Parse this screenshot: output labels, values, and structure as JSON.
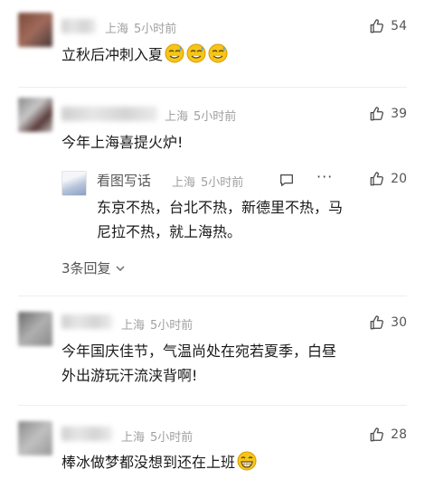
{
  "comments": [
    {
      "location": "上海",
      "time": "5小时前",
      "likes": "54",
      "text": "立秋后冲刺入夏"
    },
    {
      "location": "上海",
      "time": "5小时前",
      "likes": "39",
      "text": "今年上海喜提火炉!",
      "reply": {
        "name": "看图写话",
        "location": "上海",
        "time": "5小时前",
        "likes": "20",
        "text_line1": "东京不热，台北不热，新德里不热，马",
        "text_line2": "尼拉不热，就上海热。"
      },
      "more_replies": "3条回复"
    },
    {
      "location": "上海",
      "time": "5小时前",
      "likes": "30",
      "text_line1": "今年国庆佳节，气温尚处在宛若夏季，白昼",
      "text_line2": "外出游玩汗流浃背啊!"
    },
    {
      "location": "上海",
      "time": "5小时前",
      "likes": "28",
      "text": "棒冰做梦都没想到还在上班"
    }
  ],
  "colors": {
    "meta": "#a0a0a0",
    "text": "#1a1a1a",
    "emoji": "#f5c518"
  },
  "icons": {
    "like": "thumbs-up-icon",
    "comment": "comment-icon",
    "more": "ellipsis-icon",
    "expand": "chevron-down-icon",
    "emoji_sweat": "sweat-emoji-icon",
    "emoji_grin": "grinning-emoji-icon"
  }
}
